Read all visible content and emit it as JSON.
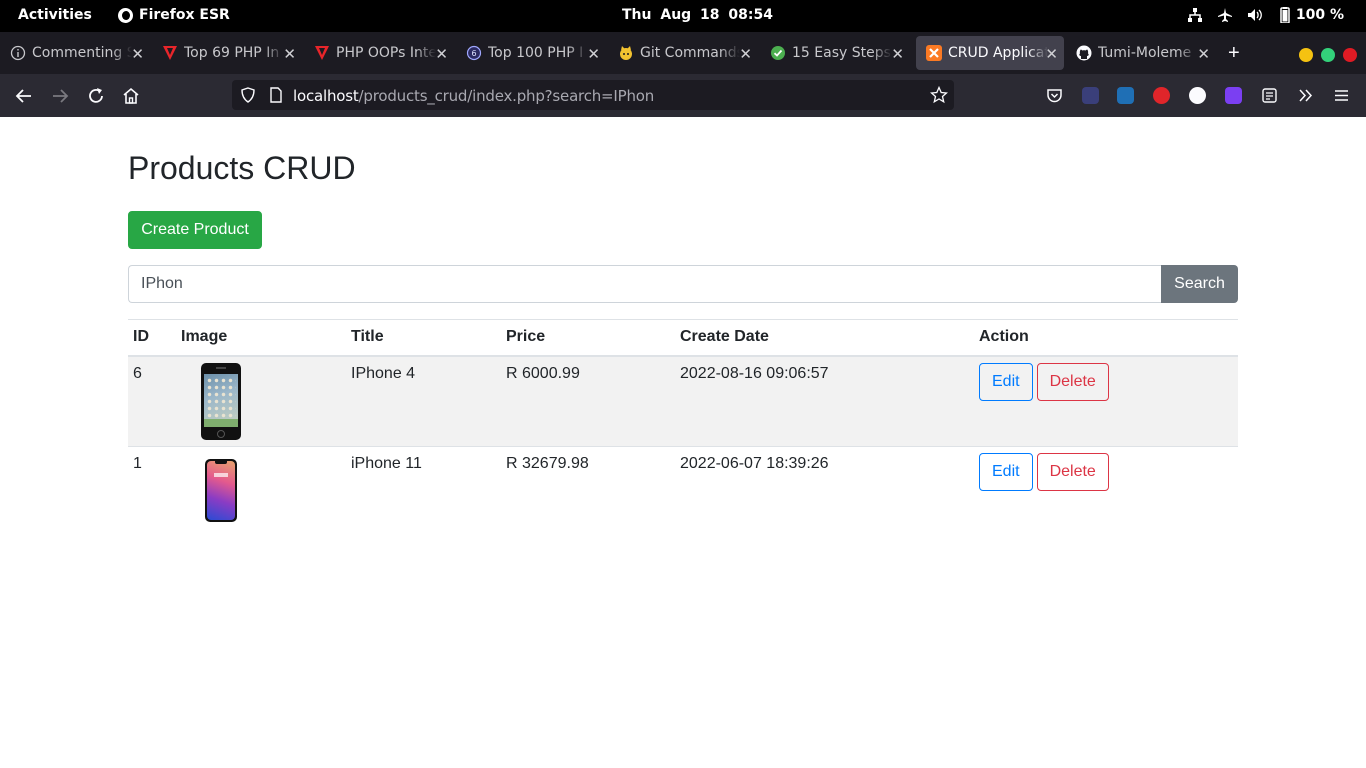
{
  "topbar": {
    "activities": "Activities",
    "app_name": "Firefox ESR",
    "clock": "Thu Aug 18  08:54",
    "battery": "100 %"
  },
  "tabs": [
    {
      "title": "Commenting S",
      "favicon": "info-icon"
    },
    {
      "title": "Top 69 PHP In",
      "favicon": "red-v-icon"
    },
    {
      "title": "PHP OOPs Inte",
      "favicon": "red-v-icon"
    },
    {
      "title": "Top 100 PHP I",
      "favicon": "blue-circle-icon"
    },
    {
      "title": "Git Commands",
      "favicon": "octocat-yellow-icon"
    },
    {
      "title": "15 Easy Steps",
      "favicon": "green-check-icon"
    },
    {
      "title": "CRUD Applicat",
      "favicon": "xampp-icon",
      "active": true
    },
    {
      "title": "Tumi-Moleme",
      "favicon": "github-icon"
    }
  ],
  "urlbar": {
    "host": "localhost",
    "path": "/products_crud/index.php?search=IPhon"
  },
  "page": {
    "heading": "Products CRUD",
    "create_button": "Create Product",
    "search_value": "IPhon",
    "search_button": "Search",
    "columns": [
      "ID",
      "Image",
      "Title",
      "Price",
      "Create Date",
      "Action"
    ],
    "rows": [
      {
        "id": "6",
        "image": "iphone-4-photo",
        "title": "IPhone 4",
        "price": "R 6000.99",
        "date": "2022-08-16 09:06:57"
      },
      {
        "id": "1",
        "image": "iphone-11-photo",
        "title": "iPhone 11",
        "price": "R 32679.98",
        "date": "2022-06-07 18:39:26"
      }
    ],
    "edit_label": "Edit",
    "delete_label": "Delete"
  },
  "colors": {
    "success": "#28a745",
    "secondary": "#6c757d",
    "primary": "#007bff",
    "danger": "#dc3545"
  }
}
